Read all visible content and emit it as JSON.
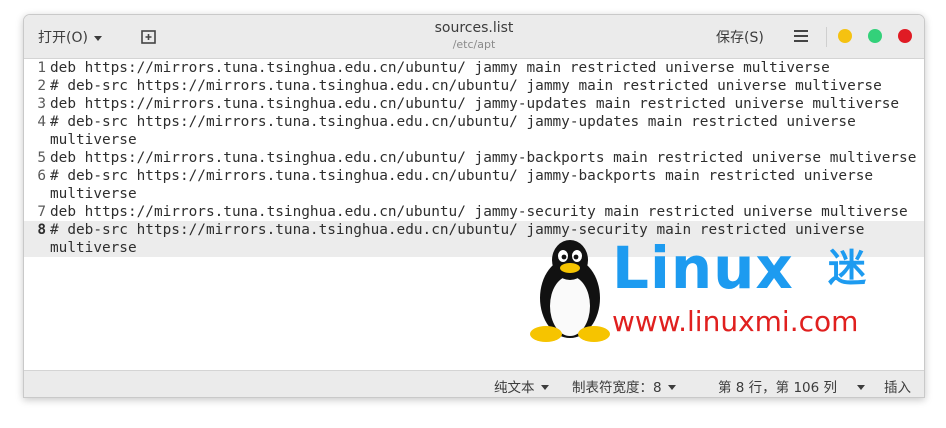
{
  "titlebar": {
    "open_label": "打开(O)",
    "title": "sources.list",
    "subtitle": "/etc/apt",
    "save_label": "保存(S)"
  },
  "editor": {
    "lines": [
      {
        "number": "1",
        "text": "deb https://mirrors.tuna.tsinghua.edu.cn/ubuntu/ jammy main restricted universe multiverse"
      },
      {
        "number": "2",
        "text": "# deb-src https://mirrors.tuna.tsinghua.edu.cn/ubuntu/ jammy main restricted universe multiverse"
      },
      {
        "number": "3",
        "text": "deb https://mirrors.tuna.tsinghua.edu.cn/ubuntu/ jammy-updates main restricted universe multiverse"
      },
      {
        "number": "4",
        "text": "# deb-src https://mirrors.tuna.tsinghua.edu.cn/ubuntu/ jammy-updates main restricted universe multiverse"
      },
      {
        "number": "5",
        "text": "deb https://mirrors.tuna.tsinghua.edu.cn/ubuntu/ jammy-backports main restricted universe multiverse"
      },
      {
        "number": "6",
        "text": "# deb-src https://mirrors.tuna.tsinghua.edu.cn/ubuntu/ jammy-backports main restricted universe multiverse"
      },
      {
        "number": "7",
        "text": "deb https://mirrors.tuna.tsinghua.edu.cn/ubuntu/ jammy-security main restricted universe multiverse"
      },
      {
        "number": "8",
        "text": "# deb-src https://mirrors.tuna.tsinghua.edu.cn/ubuntu/ jammy-security main restricted universe multiverse"
      }
    ],
    "current_line": "8"
  },
  "statusbar": {
    "language": "纯文本",
    "tab_width": "制表符宽度：8",
    "position": "第 8 行，第 106 列",
    "mode": "插入"
  },
  "watermark": {
    "brand": "Linux",
    "brand_cn": "迷",
    "url": "www.linuxmi.com"
  },
  "colors": {
    "minimize": "#f5c211",
    "maximize": "#33d17a",
    "close": "#e01b24",
    "watermark_blue": "#1d9bf0",
    "watermark_red": "#e0201f"
  }
}
